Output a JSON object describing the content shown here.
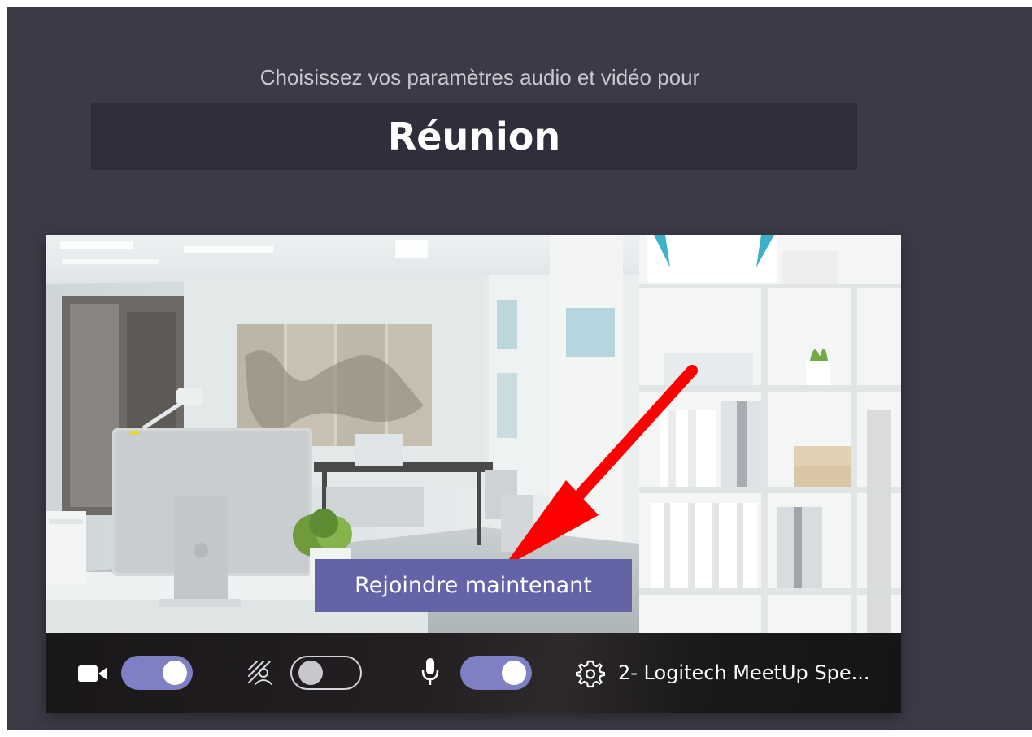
{
  "header": {
    "subtitle": "Choisissez vos paramètres audio et vidéo pour",
    "meeting_name": "Réunion"
  },
  "preview": {
    "join_button_label": "Rejoindre maintenant",
    "annotation_arrow_color": "#ff0000"
  },
  "controls": {
    "camera": {
      "icon": "video-camera-icon",
      "enabled": true
    },
    "background_effects": {
      "icon": "background-blur-icon",
      "enabled": false
    },
    "microphone": {
      "icon": "microphone-icon",
      "enabled": true
    },
    "device_settings": {
      "icon": "gear-icon",
      "label": "2- Logitech MeetUp Spe..."
    }
  },
  "colors": {
    "app_background": "#3b3a47",
    "title_box": "#2f2e3a",
    "accent": "#6264a7",
    "toggle_on": "#7f7fc4"
  }
}
